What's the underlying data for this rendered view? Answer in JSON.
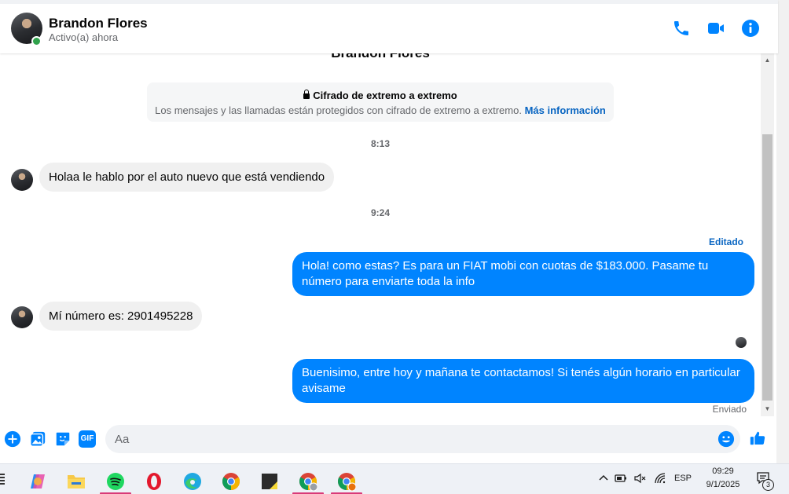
{
  "header": {
    "name": "Brandon Flores",
    "status": "Activo(a) ahora"
  },
  "conversation": {
    "cut_name": "Brandon Flores",
    "e2e_title": "Cifrado de extremo a extremo",
    "e2e_text": "Los mensajes y las llamadas están protegidos con cifrado de extremo a extremo.",
    "e2e_link": "Más información",
    "messages": [
      {
        "type": "time",
        "text": "8:13"
      },
      {
        "type": "in",
        "text": "Holaa le hablo por el auto nuevo que está vendiendo"
      },
      {
        "type": "time",
        "text": "9:24"
      },
      {
        "type": "label",
        "text": "Editado"
      },
      {
        "type": "out",
        "text": "Hola! como estas? Es para un FIAT mobi con cuotas de $183.000. Pasame tu número para enviarte toda la info"
      },
      {
        "type": "in",
        "text": "Mí número es: 2901495228"
      },
      {
        "type": "out",
        "text": "Buenisimo, entre hoy y mañana te contactamos! Si tenés algún horario en particular avisame"
      },
      {
        "type": "status",
        "text": "Enviado"
      }
    ]
  },
  "composer": {
    "placeholder": "Aa",
    "gif_label": "GIF"
  },
  "taskbar": {
    "language": "ESP",
    "time": "09:29",
    "date": "9/1/2025",
    "notifications": "3"
  },
  "colors": {
    "accent": "#0084ff",
    "incoming_bubble": "#f0f0f0",
    "online": "#31a24c",
    "link": "#0a66c2"
  },
  "icons": [
    "phone-icon",
    "video-icon",
    "info-icon",
    "plus-icon",
    "image-icon",
    "sticker-icon",
    "gif-icon",
    "emoji-icon",
    "like-icon"
  ]
}
